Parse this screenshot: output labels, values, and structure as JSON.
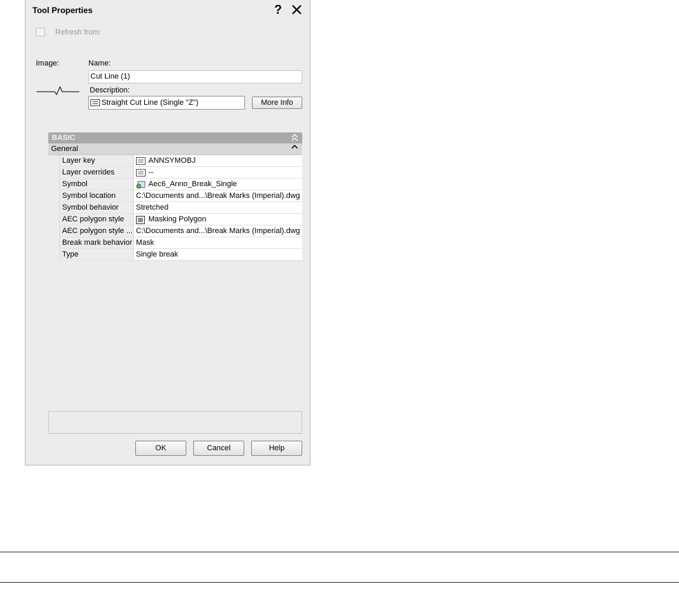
{
  "dialog": {
    "title": "Tool Properties",
    "help_glyph": "?",
    "close_icon": "close-icon"
  },
  "refresh": {
    "label": "Refresh from:",
    "checked": false
  },
  "form": {
    "image_label": "Image:",
    "name_label": "Name:",
    "name_value": "Cut Line (1)",
    "description_label": "Description:",
    "description_value": "Straight Cut Line (Single \"Z\")",
    "more_info_label": "More Info"
  },
  "properties": {
    "section": "BASIC",
    "group": "General",
    "rows": [
      {
        "name": "Layer key",
        "value": "ANNSYMOBJ",
        "icon": "layer-key-icon"
      },
      {
        "name": "Layer overrides",
        "value": "--",
        "icon": "layer-override-icon"
      },
      {
        "name": "Symbol",
        "value": "Aec6_Anno_Break_Single",
        "icon": "symbol-icon"
      },
      {
        "name": "Symbol location",
        "value": "C:\\Documents and...\\Break Marks (Imperial).dwg",
        "icon": ""
      },
      {
        "name": "Symbol behavior",
        "value": "Stretched",
        "icon": ""
      },
      {
        "name": "AEC polygon style",
        "value": "Masking Polygon",
        "icon": "polygon-style-icon"
      },
      {
        "name": "AEC polygon style ...",
        "value": "C:\\Documents and...\\Break Marks (Imperial).dwg",
        "icon": ""
      },
      {
        "name": "Break mark behavior",
        "value": "Mask",
        "icon": ""
      },
      {
        "name": "Type",
        "value": "Single break",
        "icon": ""
      }
    ]
  },
  "buttons": {
    "ok": "OK",
    "cancel": "Cancel",
    "help": "Help"
  }
}
